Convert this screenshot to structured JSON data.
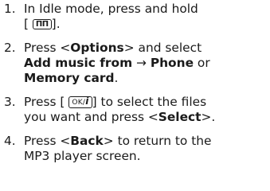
{
  "steps": [
    {
      "num": "1.",
      "line1": "In Idle mode, press and hold",
      "key_open": "[",
      "key_icon": "mp3-key-icon",
      "key_label": "ΠΠ",
      "key_close": "]",
      "end": "."
    },
    {
      "num": "2.",
      "press": "Press <",
      "options": "Options",
      "after_options": "> and select",
      "add_music_from": "Add music from",
      "arrow": " → ",
      "phone": "Phone",
      "or": " or",
      "memory_card": "Memory card",
      "end": "."
    },
    {
      "num": "3.",
      "press": "Press [",
      "key_ok": "OK/",
      "key_i": "i",
      "close": "] to select the files",
      "line2": "you want and press <",
      "select": "Select",
      "end": ">."
    },
    {
      "num": "4.",
      "press": "Press <",
      "back": "Back",
      "after_back": "> to return to the",
      "line2": "MP3 player screen."
    }
  ]
}
